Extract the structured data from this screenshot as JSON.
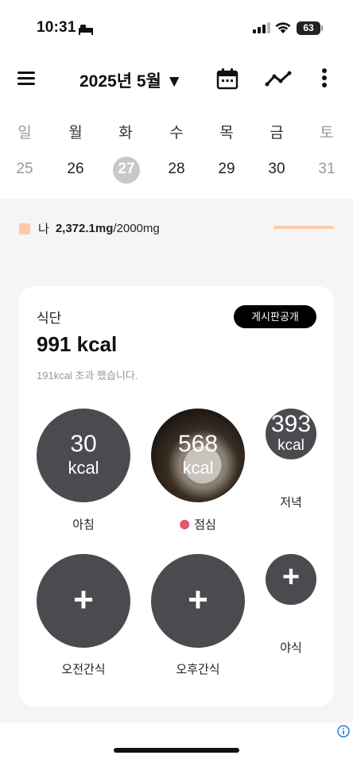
{
  "status": {
    "time": "10:31",
    "battery": "63"
  },
  "header": {
    "month_title": "2025년 5월 ▼"
  },
  "week": {
    "days": [
      "일",
      "월",
      "화",
      "수",
      "목",
      "금",
      "토"
    ],
    "dates": [
      "25",
      "26",
      "27",
      "28",
      "29",
      "30",
      "31"
    ],
    "selected_index": 2
  },
  "nutrients": {
    "sodium": {
      "name": "나",
      "value": "2,372.1mg",
      "goal": "/2000mg"
    }
  },
  "meal_card": {
    "title": "식단",
    "publish_label": "게시판공개",
    "total": "991 kcal",
    "over_text": "191kcal 초과 했습니다.",
    "meals": [
      {
        "name": "아침",
        "kcal": "30",
        "unit": "kcal"
      },
      {
        "name": "점심",
        "kcal": "568",
        "unit": "kcal"
      },
      {
        "name": "저녁",
        "kcal": "393",
        "unit": "kcal"
      },
      {
        "name": "오전간식",
        "plus": "+"
      },
      {
        "name": "오후간식",
        "plus": "+"
      },
      {
        "name": "야식",
        "plus": "+"
      }
    ]
  },
  "colors": {
    "accent_dot": "#e8566d",
    "circle": "#494b4f",
    "sodium_swatch": "#ffc9a6"
  }
}
